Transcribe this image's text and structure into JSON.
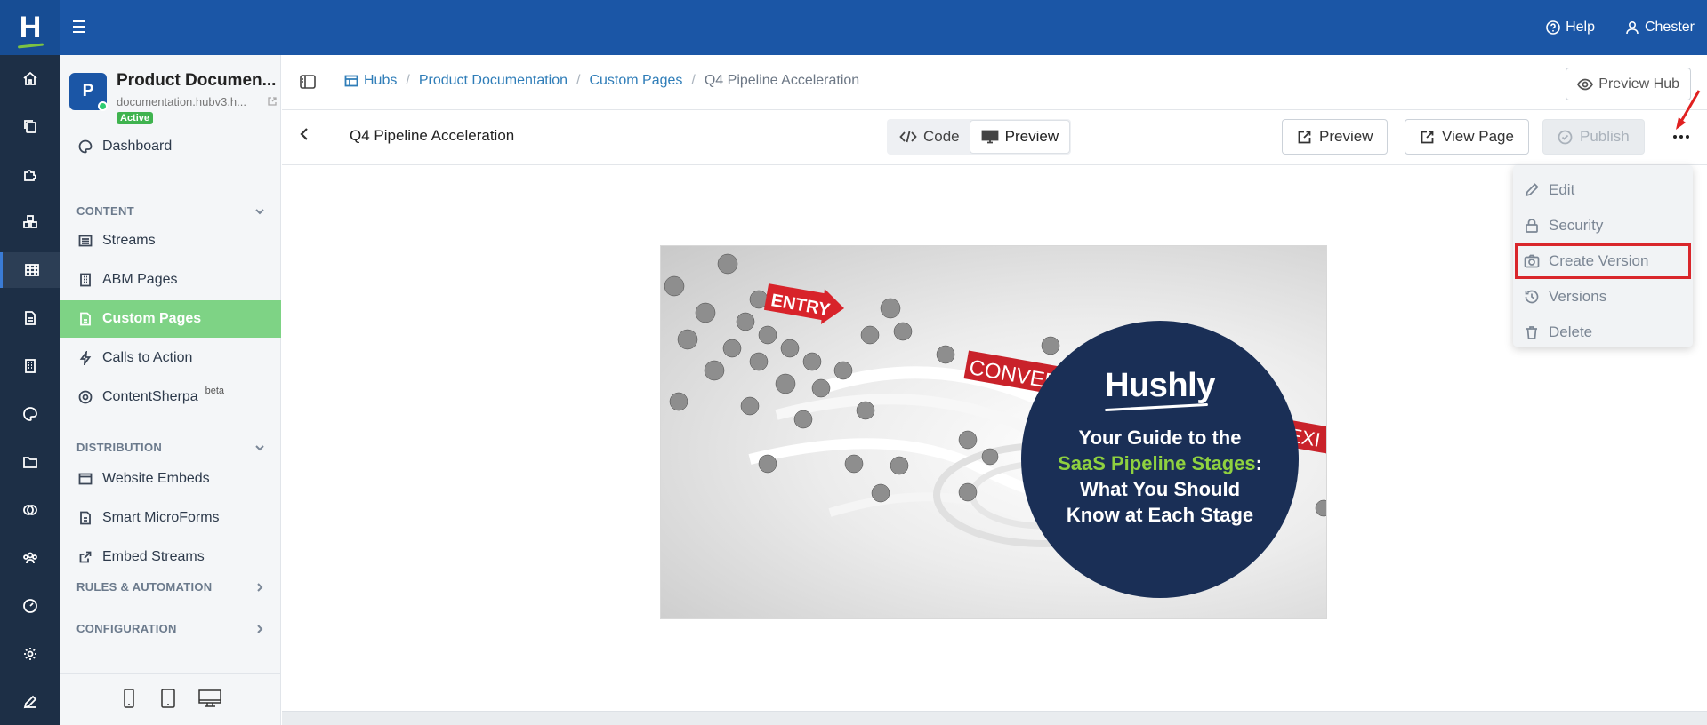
{
  "app": {
    "logo_letter": "H",
    "help_label": "Help",
    "user_name": "Chester"
  },
  "hub": {
    "avatar_letter": "P",
    "name": "Product Documen...",
    "url": "documentation.hubv3.h...",
    "status": "Active"
  },
  "sidebar": {
    "dashboard": "Dashboard",
    "content_section": "CONTENT",
    "items": [
      {
        "label": "Streams",
        "icon": "list-icon"
      },
      {
        "label": "ABM Pages",
        "icon": "building-icon"
      },
      {
        "label": "Custom Pages",
        "icon": "page-icon",
        "active": true
      },
      {
        "label": "Calls to Action",
        "icon": "bolt-icon"
      },
      {
        "label": "ContentSherpa",
        "icon": "sherpa-icon",
        "badge": "beta"
      }
    ],
    "distribution_section": "DISTRIBUTION",
    "distribution_items": [
      {
        "label": "Website Embeds",
        "icon": "window-icon"
      },
      {
        "label": "Smart MicroForms",
        "icon": "form-icon"
      },
      {
        "label": "Embed Streams",
        "icon": "share-icon"
      }
    ],
    "rules_section": "RULES & AUTOMATION",
    "config_section": "CONFIGURATION"
  },
  "breadcrumb": {
    "items": [
      "Hubs",
      "Product Documentation",
      "Custom Pages",
      "Q4 Pipeline Acceleration"
    ],
    "separator": "/"
  },
  "header": {
    "preview_hub_label": "Preview Hub"
  },
  "toolbar": {
    "page_title": "Q4 Pipeline Acceleration",
    "code_label": "Code",
    "preview_toggle_label": "Preview",
    "preview_label": "Preview",
    "view_page_label": "View Page",
    "publish_label": "Publish"
  },
  "menu": {
    "items": [
      {
        "label": "Edit",
        "icon": "pencil-icon"
      },
      {
        "label": "Security",
        "icon": "lock-icon"
      },
      {
        "label": "Create Version",
        "icon": "camera-icon",
        "highlighted": true
      },
      {
        "label": "Versions",
        "icon": "history-icon"
      },
      {
        "label": "Delete",
        "icon": "trash-icon"
      }
    ]
  },
  "banner": {
    "sign_entry": "ENTRY",
    "sign_conversion": "CONVERSION",
    "sign_exit": "EXI",
    "brand": "Hushly",
    "line1": "Your Guide to the",
    "highlight": "SaaS Pipeline Stages",
    "colon": ":",
    "line3": "What You Should",
    "line4": "Know at Each Stage"
  },
  "colors": {
    "topbar": "#1b56a6",
    "rail": "#1d2f46",
    "active_nav": "#7ed385",
    "highlight_outline": "#d9262b",
    "banner_circle": "#1a2f56",
    "banner_highlight": "#8fd13f"
  }
}
